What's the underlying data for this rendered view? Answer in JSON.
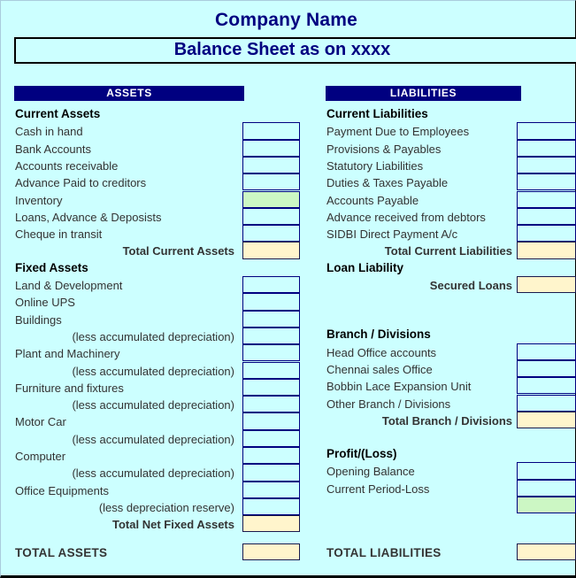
{
  "document": {
    "company_title": "Company Name",
    "subtitle": "Balance Sheet as on xxxx"
  },
  "colors": {
    "background": "#ccffff",
    "header_bar": "#000080",
    "title_text": "#000080",
    "cell_border": "#000080",
    "cell_input": "#ccffff",
    "cell_highlight_green": "#ccf7c4",
    "cell_total_yellow": "#fff5cc"
  },
  "assets": {
    "header": "ASSETS",
    "groups": [
      {
        "title": "Current Assets",
        "rows": [
          {
            "label": "Cash in hand",
            "cell": "input"
          },
          {
            "label": "Bank Accounts",
            "cell": "input"
          },
          {
            "label": "Accounts receivable",
            "cell": "input"
          },
          {
            "label": "Advance Paid to creditors",
            "cell": "input"
          },
          {
            "label": "Inventory",
            "cell": "green"
          },
          {
            "label": "Loans, Advance & Deposists",
            "cell": "input"
          },
          {
            "label": "Cheque in transit",
            "cell": "input"
          },
          {
            "label": "Total Current Assets",
            "cell": "total"
          }
        ]
      },
      {
        "title": "Fixed Assets",
        "rows": [
          {
            "label": "Land & Development",
            "cell": "input"
          },
          {
            "label": "Online UPS",
            "cell": "input"
          },
          {
            "label": "Buildings",
            "cell": "input"
          },
          {
            "label": "(less accumulated depreciation)",
            "cell": "input"
          },
          {
            "label": "Plant and Machinery",
            "cell": "input"
          },
          {
            "label": "(less accumulated depreciation)",
            "cell": "input"
          },
          {
            "label": "Furniture and fixtures",
            "cell": "input"
          },
          {
            "label": "(less accumulated depreciation)",
            "cell": "input"
          },
          {
            "label": "Motor Car",
            "cell": "input"
          },
          {
            "label": "(less accumulated depreciation)",
            "cell": "input"
          },
          {
            "label": "Computer",
            "cell": "input"
          },
          {
            "label": "(less accumulated depreciation)",
            "cell": "input"
          },
          {
            "label": "Office Equipments",
            "cell": "input"
          },
          {
            "label": "(less depreciation reserve)",
            "cell": "input"
          },
          {
            "label": "Total Net Fixed Assets",
            "cell": "total"
          }
        ]
      }
    ],
    "grand_total": {
      "label": "TOTAL ASSETS",
      "cell": "total"
    }
  },
  "liabilities": {
    "header": "LIABILITIES",
    "groups": [
      {
        "title": "Current Liabilities",
        "rows": [
          {
            "label": "Payment Due to Employees",
            "cell": "input"
          },
          {
            "label": "Provisions & Payables",
            "cell": "input"
          },
          {
            "label": "Statutory Liabilities",
            "cell": "input"
          },
          {
            "label": "Duties & Taxes Payable",
            "cell": "input"
          },
          {
            "label": "Accounts Payable",
            "cell": "input"
          },
          {
            "label": "Advance received from debtors",
            "cell": "input"
          },
          {
            "label": "SIDBI Direct Payment A/c",
            "cell": "input"
          },
          {
            "label": "Total Current Liabilities",
            "cell": "total"
          }
        ]
      },
      {
        "title": "Loan Liability",
        "rows": [
          {
            "label": "Secured Loans",
            "cell": "total"
          }
        ]
      },
      {
        "title": "Branch / Divisions",
        "rows": [
          {
            "label": "Head Office accounts",
            "cell": "input"
          },
          {
            "label": "Chennai sales Office",
            "cell": "input"
          },
          {
            "label": "Bobbin Lace Expansion Unit",
            "cell": "input"
          },
          {
            "label": "Other Branch / Divisions",
            "cell": "input"
          },
          {
            "label": "Total Branch / Divisions",
            "cell": "total"
          }
        ]
      },
      {
        "title": "Profit/(Loss)",
        "rows": [
          {
            "label": "Opening Balance",
            "cell": "input"
          },
          {
            "label": "Current Period-Loss",
            "cell": "input"
          },
          {
            "label": "",
            "cell": "green"
          }
        ]
      }
    ],
    "grand_total": {
      "label": "TOTAL LIABILITIES",
      "cell": "total"
    }
  }
}
